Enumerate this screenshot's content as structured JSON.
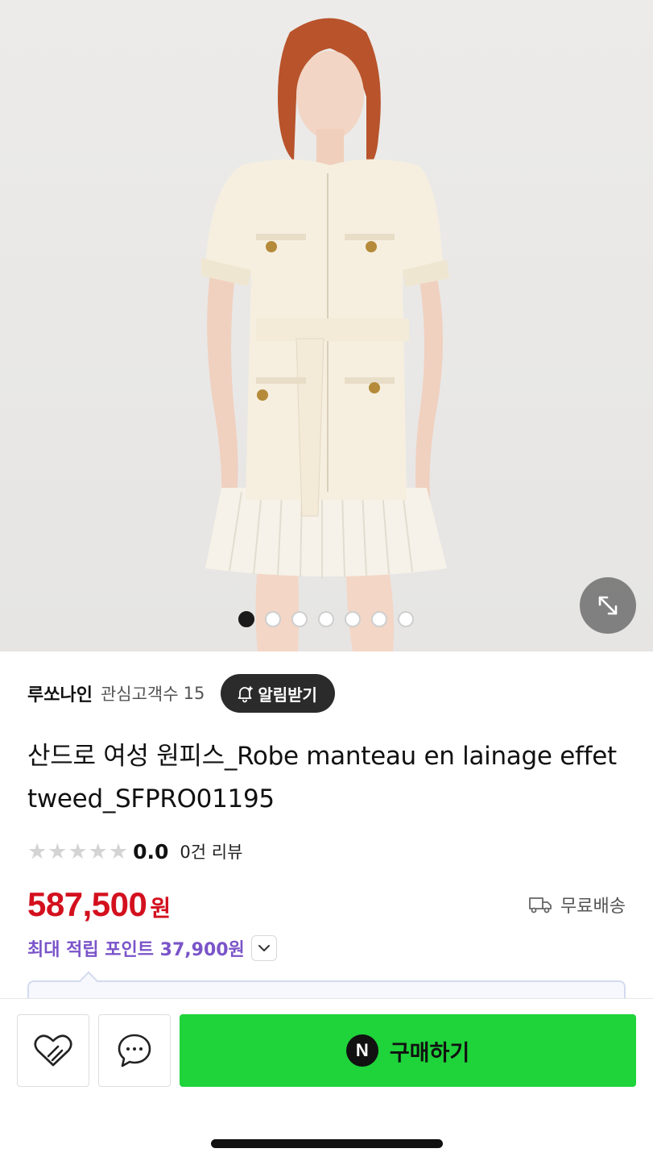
{
  "gallery": {
    "image_count": 7,
    "active_index": 0,
    "expand_icon": "expand-diagonal-icon"
  },
  "store": {
    "name": "루쏘나인",
    "fans_label": "관심고객수",
    "fans_count": "15",
    "alert_label": "알림받기",
    "alert_icon": "bell-plus-icon"
  },
  "product": {
    "title": "산드로 여성 원피스_Robe manteau en lainage effet tweed_SFPRO01195",
    "rating_value": "0.0",
    "rating_stars": 0,
    "review_label": "0건 리뷰",
    "price": "587,500",
    "currency": "원",
    "shipping_label": "무료배송",
    "points_label": "최대 적립 포인트 37,900원"
  },
  "actions": {
    "buy_label": "구매하기",
    "buy_badge": "N",
    "like_icon": "heart-icon",
    "chat_icon": "chat-bubble-icon"
  },
  "colors": {
    "price": "#d3101e",
    "points": "#7a54c9",
    "buy_button": "#1fd33a"
  }
}
